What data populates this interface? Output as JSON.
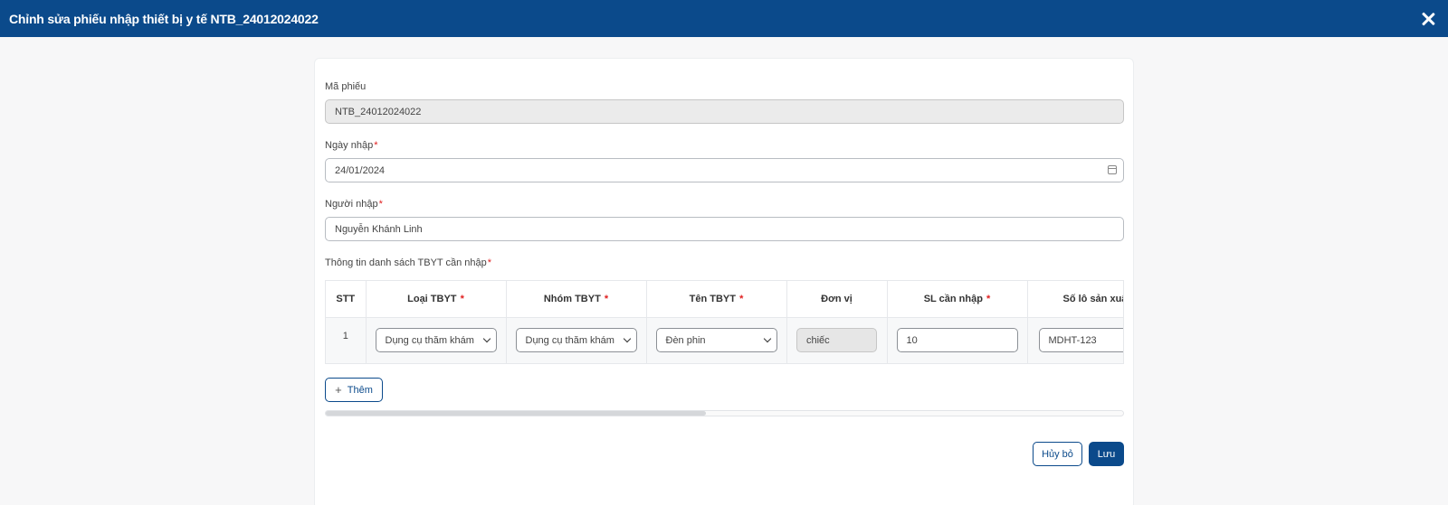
{
  "header": {
    "title": "Chỉnh sửa phiếu nhập thiết bị y tế NTB_24012024022"
  },
  "form": {
    "ma_phieu": {
      "label": "Mã phiếu",
      "value": "NTB_24012024022"
    },
    "ngay_nhap": {
      "label": "Ngày nhập",
      "required": "*",
      "value": "24/01/2024"
    },
    "nguoi_nhap": {
      "label": "Người nhập",
      "required": "*",
      "value": "Nguyễn Khánh Linh"
    },
    "danh_sach": {
      "label": "Thông tin danh sách TBYT cần nhập",
      "required": "*"
    }
  },
  "table": {
    "headers": {
      "stt": "STT",
      "loai": "Loại TBYT",
      "nhom": "Nhóm TBYT",
      "ten": "Tên TBYT",
      "don_vi": "Đơn vị",
      "sl": "SL cần nhập",
      "so_lo": "Số lô sản xuất"
    },
    "rows": [
      {
        "stt": "1",
        "loai": "Dụng cụ thăm khám",
        "nhom": "Dụng cụ thăm khám",
        "ten": "Đèn phin",
        "don_vi": "chiếc",
        "sl": "10",
        "so_lo": "MDHT-123"
      }
    ]
  },
  "actions": {
    "add": "Thêm",
    "cancel": "Hủy bỏ",
    "save": "Lưu"
  },
  "colors": {
    "primary": "#0b4a8b",
    "required": "#e02020"
  }
}
